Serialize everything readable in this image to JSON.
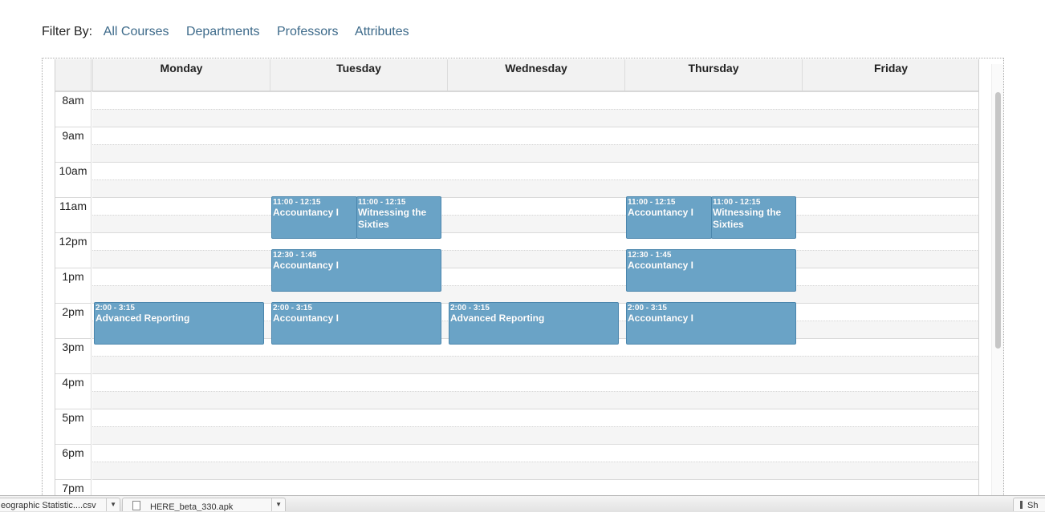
{
  "filter": {
    "label": "Filter By:",
    "links": [
      "All Courses",
      "Departments",
      "Professors",
      "Attributes"
    ]
  },
  "days": [
    "Monday",
    "Tuesday",
    "Wednesday",
    "Thursday",
    "Friday"
  ],
  "hours": [
    "8am",
    "9am",
    "10am",
    "11am",
    "12pm",
    "1pm",
    "2pm",
    "3pm",
    "4pm",
    "5pm",
    "6pm",
    "7pm"
  ],
  "events": {
    "tue_1": {
      "time": "11:00 - 12:15",
      "title": "Accountancy I"
    },
    "tue_2": {
      "time": "11:00 - 12:15",
      "title": "Witnessing the Sixties"
    },
    "thu_1": {
      "time": "11:00 - 12:15",
      "title": "Accountancy I"
    },
    "thu_2": {
      "time": "11:00 - 12:15",
      "title": "Witnessing the Sixties"
    },
    "tue_3": {
      "time": "12:30 - 1:45",
      "title": "Accountancy I"
    },
    "thu_3": {
      "time": "12:30 - 1:45",
      "title": "Accountancy I"
    },
    "mon_1": {
      "time": "2:00 - 3:15",
      "title": "Advanced Reporting"
    },
    "tue_4": {
      "time": "2:00 - 3:15",
      "title": "Accountancy I"
    },
    "wed_1": {
      "time": "2:00 - 3:15",
      "title": "Advanced Reporting"
    },
    "thu_4": {
      "time": "2:00 - 3:15",
      "title": "Accountancy I"
    }
  },
  "downloads": [
    "eographic Statistic....csv",
    "HERE_beta_330.apk",
    "Sh"
  ],
  "colors": {
    "event_fill": "#6aa3c6",
    "event_border": "#4b86ad",
    "link": "#3d6a8a"
  }
}
